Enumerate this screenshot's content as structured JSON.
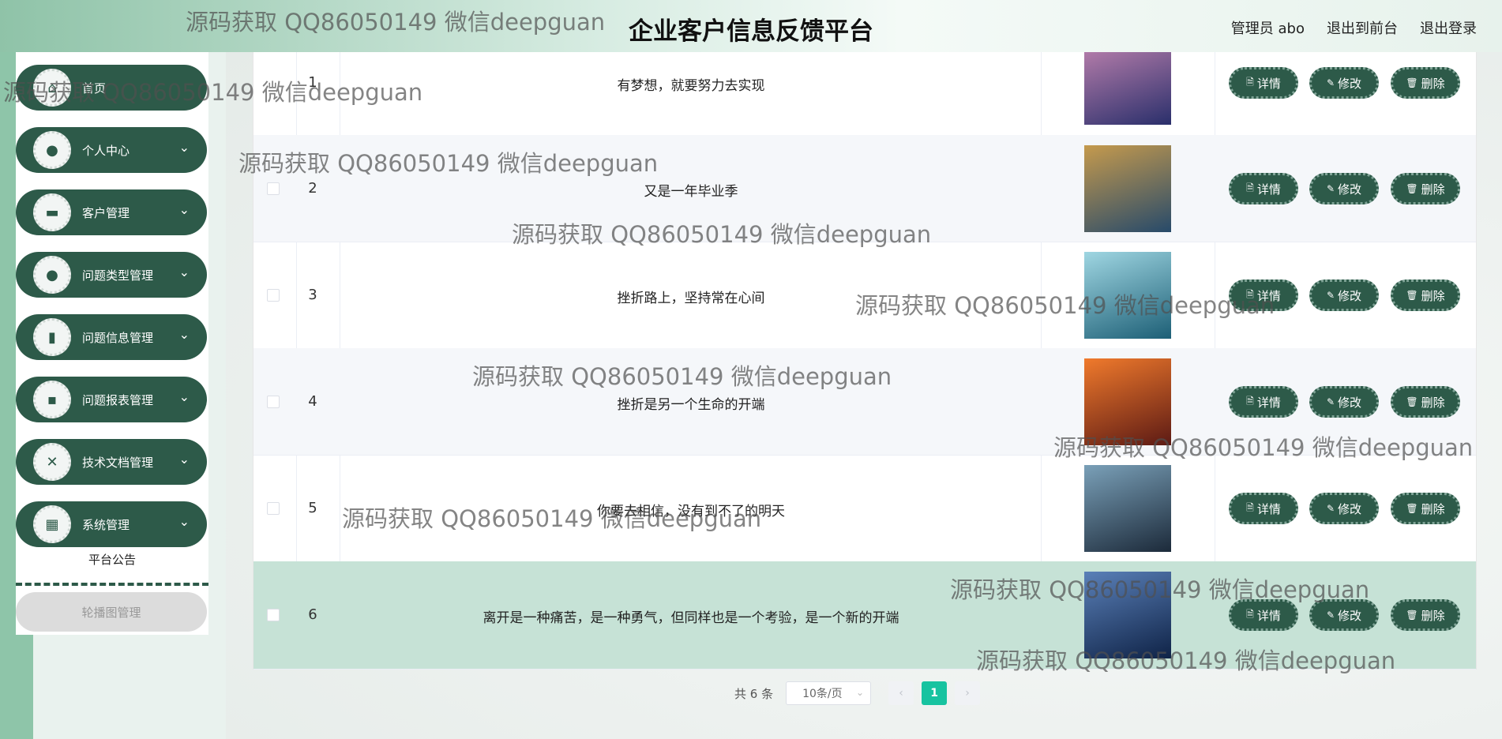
{
  "header": {
    "title": "企业客户信息反馈平台",
    "admin_label": "管理员 abo",
    "back_to_front": "退出到前台",
    "logout": "退出登录"
  },
  "sidebar": {
    "items": [
      {
        "label": "首页",
        "icon": "home-icon"
      },
      {
        "label": "个人中心",
        "icon": "user-icon"
      },
      {
        "label": "客户管理",
        "icon": "monitor-icon"
      },
      {
        "label": "问题类型管理",
        "icon": "user-icon"
      },
      {
        "label": "问题信息管理",
        "icon": "book-icon"
      },
      {
        "label": "问题报表管理",
        "icon": "chat-icon"
      },
      {
        "label": "技术文档管理",
        "icon": "doc-icon"
      },
      {
        "label": "系统管理",
        "icon": "grid-icon"
      }
    ],
    "sub_items": {
      "notice": "平台公告",
      "carousel": "轮播图管理"
    }
  },
  "table": {
    "rows": [
      {
        "index": "1",
        "content": "有梦想，就要努力去实现",
        "image_colors": [
          "#2a2f6b",
          "#b07aa8"
        ]
      },
      {
        "index": "2",
        "content": "又是一年毕业季",
        "image_colors": [
          "#274a6a",
          "#c59a4d"
        ]
      },
      {
        "index": "3",
        "content": "挫折路上，坚持常在心间",
        "image_colors": [
          "#1d5f76",
          "#9fd6e2"
        ]
      },
      {
        "index": "4",
        "content": "挫折是另一个生命的开端",
        "image_colors": [
          "#5c1a14",
          "#f07a2c"
        ]
      },
      {
        "index": "5",
        "content": "你要去相信，没有到不了的明天",
        "image_colors": [
          "#1c2a3a",
          "#7aa0b8"
        ]
      },
      {
        "index": "6",
        "content": "离开是一种痛苦，是一种勇气，但同样也是一个考验，是一个新的开端",
        "image_colors": [
          "#0f2347",
          "#5a80b8"
        ]
      }
    ],
    "actions": {
      "detail": "详情",
      "edit": "修改",
      "delete": "删除"
    }
  },
  "pagination": {
    "total": "共 6 条",
    "page_size": "10条/页",
    "current_page": "1",
    "prev": "‹",
    "next": "›"
  },
  "watermark": "源码获取 QQ86050149 微信deepguan"
}
